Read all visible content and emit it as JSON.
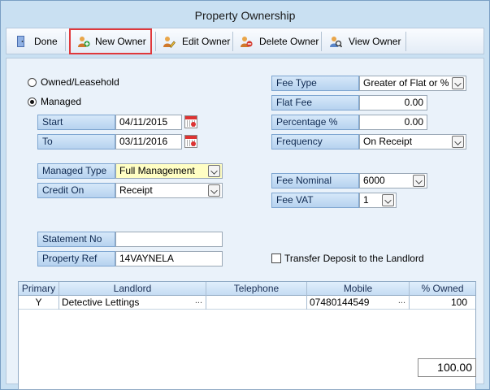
{
  "window": {
    "title": "Property Ownership"
  },
  "toolbar": {
    "done": "Done",
    "new_owner": "New Owner",
    "edit_owner": "Edit Owner",
    "delete_owner": "Delete Owner",
    "view_owner": "View Owner"
  },
  "ownership": {
    "option_owned": "Owned/Leasehold",
    "option_managed": "Managed",
    "selected": "Managed"
  },
  "dates": {
    "start_label": "Start",
    "start_value": "04/11/2015",
    "to_label": "To",
    "to_value": "03/11/2016"
  },
  "management": {
    "managed_type_label": "Managed Type",
    "managed_type_value": "Full Management",
    "credit_on_label": "Credit On",
    "credit_on_value": "Receipt"
  },
  "refs": {
    "statement_no_label": "Statement No",
    "statement_no_value": "",
    "property_ref_label": "Property Ref",
    "property_ref_value": "14VAYNELA"
  },
  "fees": {
    "fee_type_label": "Fee Type",
    "fee_type_value": "Greater of Flat or %",
    "flat_fee_label": "Flat Fee",
    "flat_fee_value": "0.00",
    "percentage_label": "Percentage %",
    "percentage_value": "0.00",
    "frequency_label": "Frequency",
    "frequency_value": "On Receipt",
    "fee_nominal_label": "Fee Nominal",
    "fee_nominal_value": "6000",
    "fee_vat_label": "Fee VAT",
    "fee_vat_value": "1"
  },
  "transfer_deposit": {
    "label": "Transfer Deposit to the Landlord",
    "checked": false
  },
  "owners_table": {
    "columns": [
      "Primary",
      "Landlord",
      "Telephone",
      "Mobile",
      "% Owned"
    ],
    "rows": [
      {
        "primary": "Y",
        "landlord": "Detective Lettings",
        "telephone": "",
        "mobile": "07480144549",
        "owned": "100"
      }
    ],
    "ellipsis": "...",
    "total": "100.00"
  },
  "colors": {
    "highlight": "#e0383b",
    "label_bg": "#c6ddf4",
    "window_bg": "#c9e0f2"
  }
}
